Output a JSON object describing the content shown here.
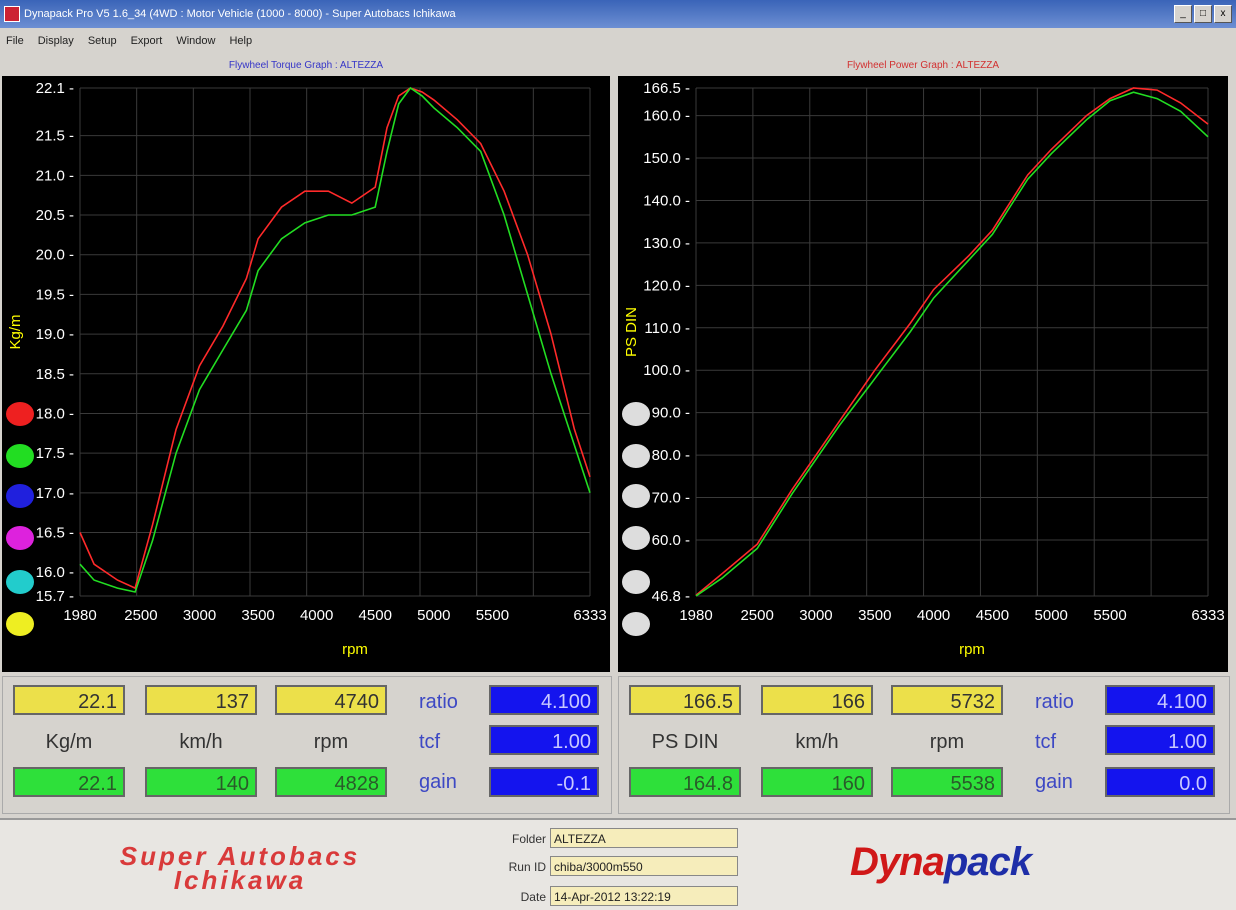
{
  "window": {
    "title": "Dynapack Pro V5 1.6_34 (4WD : Motor Vehicle (1000 - 8000) - Super Autobacs Ichikawa",
    "min_label": "_",
    "max_label": "□",
    "close_label": "x"
  },
  "menu": [
    "File",
    "Display",
    "Setup",
    "Export",
    "Window",
    "Help"
  ],
  "torque_graph": {
    "title": "Flywheel Torque Graph : ALTEZZA",
    "ylabel": "Kg/m",
    "xlabel": "rpm",
    "ytick_labels": [
      "22.1",
      "21.5",
      "21.0",
      "20.5",
      "20.0",
      "19.5",
      "19.0",
      "18.5",
      "18.0",
      "17.5",
      "17.0",
      "16.5",
      "16.0",
      "15.7"
    ],
    "xtick_labels": [
      "1980",
      "2500",
      "3000",
      "3500",
      "4000",
      "4500",
      "5000",
      "5500",
      "6333"
    ]
  },
  "power_graph": {
    "title": "Flywheel Power Graph : ALTEZZA",
    "ylabel": "PS DIN",
    "xlabel": "rpm",
    "ytick_labels": [
      "166.5",
      "160.0",
      "150.0",
      "140.0",
      "130.0",
      "120.0",
      "110.0",
      "100.0",
      "90.0",
      "80.0",
      "70.0",
      "60.0",
      "46.8"
    ],
    "xtick_labels": [
      "1980",
      "2500",
      "3000",
      "3500",
      "4000",
      "4500",
      "5000",
      "5500",
      "6333"
    ]
  },
  "readouts_left": {
    "max_val": "22.1",
    "max_speed": "137",
    "max_rpm": "4740",
    "unit_val": "Kg/m",
    "unit_speed": "km/h",
    "unit_rpm": "rpm",
    "cur_val": "22.1",
    "cur_speed": "140",
    "cur_rpm": "4828",
    "ratio_label": "ratio",
    "tcf_label": "tcf",
    "gain_label": "gain",
    "ratio": "4.100",
    "tcf": "1.00",
    "gain": "-0.1"
  },
  "readouts_right": {
    "max_val": "166.5",
    "max_speed": "166",
    "max_rpm": "5732",
    "unit_val": "PS DIN",
    "unit_speed": "km/h",
    "unit_rpm": "rpm",
    "cur_val": "164.8",
    "cur_speed": "160",
    "cur_rpm": "5538",
    "ratio_label": "ratio",
    "tcf_label": "tcf",
    "gain_label": "gain",
    "ratio": "4.100",
    "tcf": "1.00",
    "gain": "0.0"
  },
  "footer": {
    "brand_line1": "Super Autobacs",
    "brand_line2": "Ichikawa",
    "folder_label": "Folder",
    "folder_value": "ALTEZZA",
    "run_label": "Run ID",
    "run_value": "chiba/3000m550",
    "date_label": "Date",
    "date_value": "14-Apr-2012  13:22:19",
    "logo_a": "Dyna",
    "logo_b": "pack"
  },
  "colors": {
    "run1": "#ff2a2a",
    "run2": "#22dd22",
    "grid": "#3a3a3a",
    "axis_text": "#ffff00",
    "tick_text": "#ffffff"
  },
  "chart_data": [
    {
      "type": "line",
      "title": "Flywheel Torque Graph : ALTEZZA",
      "xlabel": "rpm",
      "ylabel": "Kg/m",
      "xlim": [
        1980,
        6333
      ],
      "ylim": [
        15.7,
        22.1
      ],
      "grid": true,
      "series": [
        {
          "x": [
            1980,
            2100,
            2300,
            2450,
            2600,
            2800,
            3000,
            3200,
            3400,
            3500,
            3700,
            3900,
            4100,
            4300,
            4500,
            4600,
            4700,
            4800,
            4900,
            5000,
            5200,
            5400,
            5600,
            5800,
            6000,
            6200,
            6333
          ],
          "y": [
            16.5,
            16.1,
            15.9,
            15.8,
            16.6,
            17.8,
            18.6,
            19.1,
            19.7,
            20.2,
            20.6,
            20.8,
            20.8,
            20.65,
            20.85,
            21.6,
            22.0,
            22.1,
            22.05,
            21.95,
            21.7,
            21.4,
            20.8,
            20.0,
            19.0,
            17.8,
            17.2
          ]
        },
        {
          "x": [
            1980,
            2100,
            2300,
            2450,
            2600,
            2800,
            3000,
            3200,
            3400,
            3500,
            3700,
            3900,
            4100,
            4300,
            4500,
            4600,
            4700,
            4800,
            4900,
            5000,
            5200,
            5400,
            5600,
            5800,
            6000,
            6200,
            6333
          ],
          "y": [
            16.1,
            15.9,
            15.8,
            15.75,
            16.4,
            17.5,
            18.3,
            18.8,
            19.3,
            19.8,
            20.2,
            20.4,
            20.5,
            20.5,
            20.6,
            21.3,
            21.9,
            22.1,
            22.0,
            21.85,
            21.6,
            21.3,
            20.5,
            19.5,
            18.5,
            17.6,
            17.0
          ]
        }
      ]
    },
    {
      "type": "line",
      "title": "Flywheel Power Graph : ALTEZZA",
      "xlabel": "rpm",
      "ylabel": "PS DIN",
      "xlim": [
        1980,
        6333
      ],
      "ylim": [
        46.8,
        166.5
      ],
      "grid": true,
      "series": [
        {
          "x": [
            1980,
            2200,
            2500,
            2800,
            3000,
            3200,
            3500,
            3800,
            4000,
            4300,
            4500,
            4800,
            5000,
            5300,
            5500,
            5700,
            5900,
            6100,
            6333
          ],
          "y": [
            47,
            52,
            59,
            72,
            80,
            88,
            100,
            111,
            119,
            127,
            133,
            146,
            152,
            160,
            164,
            166.5,
            166,
            163,
            158
          ]
        },
        {
          "x": [
            1980,
            2200,
            2500,
            2800,
            3000,
            3200,
            3500,
            3800,
            4000,
            4300,
            4500,
            4800,
            5000,
            5300,
            5500,
            5700,
            5900,
            6100,
            6333
          ],
          "y": [
            46.8,
            51,
            58,
            71,
            79,
            87,
            98,
            109,
            117,
            126,
            132,
            145,
            151,
            159,
            163.5,
            165.5,
            164,
            161,
            155
          ]
        }
      ]
    }
  ]
}
